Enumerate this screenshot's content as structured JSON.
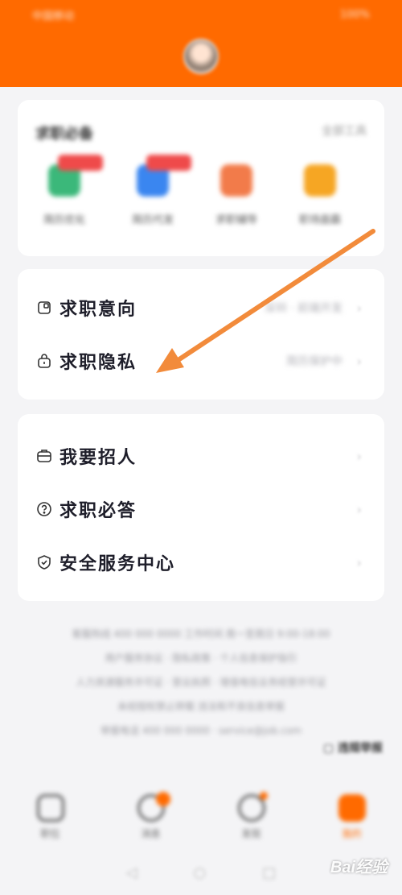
{
  "status_bar": {
    "left": "中国移动",
    "right": "100%"
  },
  "tools_card": {
    "title": "求职必备",
    "more": "全部工具",
    "items": [
      {
        "label": "简历优化",
        "color": "#3bb87a",
        "badge": true
      },
      {
        "label": "简历代发",
        "color": "#3a86f0",
        "badge": true
      },
      {
        "label": "求职辅导",
        "color": "#f27b4a",
        "badge": false
      },
      {
        "label": "职场面霸",
        "color": "#f6a623",
        "badge": false
      }
    ]
  },
  "job_card": {
    "intent": {
      "label": "求职意向",
      "value": "深圳 · 前端开发"
    },
    "privacy": {
      "label": "求职隐私",
      "value": "简历保护中"
    }
  },
  "more_card": {
    "recruit": {
      "label": "我要招人"
    },
    "faq": {
      "label": "求职必答"
    },
    "safety": {
      "label": "安全服务中心"
    }
  },
  "footer": {
    "lines": [
      "客服热线 400 000 0000 工作时间 周一至周日 9:00-18:00",
      "用户服务协议 · 隐私政策 · 个人信息保护指引",
      "人力资源服务许可证 · 营业执照 · 增值电信业务经营许可证",
      "未经授权禁止转载 违法和不良信息举报",
      "举报电话 400 000 0000 · service@job.com"
    ],
    "report": "违规举报"
  },
  "tabs": [
    {
      "label": "职位",
      "active": false,
      "dot": false
    },
    {
      "label": "消息",
      "active": false,
      "dot": true
    },
    {
      "label": "发现",
      "active": false,
      "dot": true
    },
    {
      "label": "我的",
      "active": true,
      "dot": false
    }
  ],
  "system_nav": {
    "back": "◁",
    "home": "○",
    "recent": "□"
  },
  "watermark": "Bai经验",
  "colors": {
    "brand": "#ff6a00",
    "annotation_arrow": "#f28b3b"
  }
}
